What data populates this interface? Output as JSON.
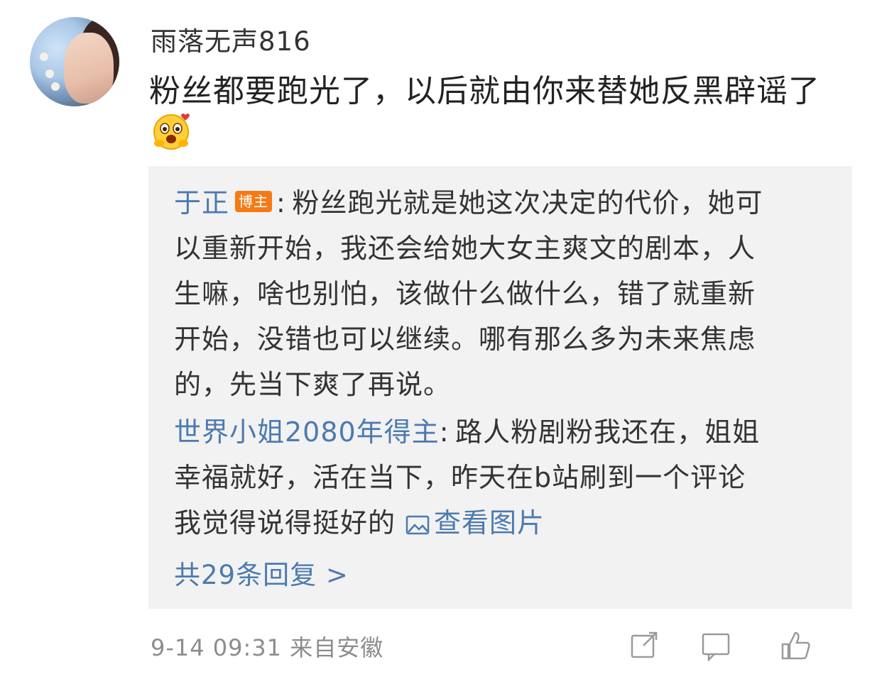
{
  "comment": {
    "username": "雨落无声816",
    "text": "粉丝都要跑光了，以后就由你来替她反黑辟谣了",
    "emoji_icon": "love-face-emoji",
    "timestamp": "9-14 09:31",
    "source": "来自安徽"
  },
  "replies": [
    {
      "author": "于正",
      "badge": "博主",
      "lines": [
        "粉丝跑光就是她这次决定的代价，她可",
        "以重新开始，我还会给她大女主爽文的剧本，人",
        "生嘛，啥也别怕，该做什么做什么，错了就重新",
        "开始，没错也可以继续。哪有那么多为未来焦虑",
        "的，先当下爽了再说。"
      ]
    },
    {
      "author": "世界小姐2080年得主",
      "lines": [
        "路人粉剧粉我还在，姐姐",
        "幸福就好，活在当下，昨天在b站刷到一个评论",
        "我觉得说得挺好的"
      ],
      "view_image_label": "查看图片"
    }
  ],
  "more_replies_label": "共29条回复 >",
  "colors": {
    "link": "#4c7ab0",
    "badge": "#f47a16",
    "reply_bg": "#f2f2f2",
    "meta": "#8c8c8c"
  }
}
